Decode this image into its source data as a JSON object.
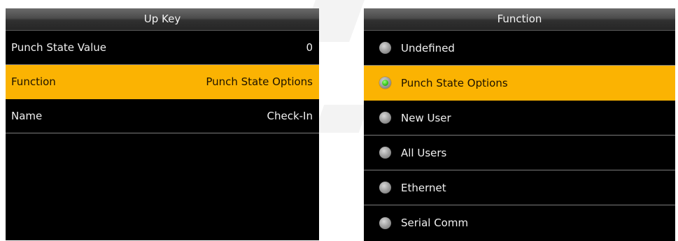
{
  "left_panel": {
    "title": "Up Key",
    "rows": [
      {
        "label": "Punch State Value",
        "value": "0"
      },
      {
        "label": "Function",
        "value": "Punch State Options"
      },
      {
        "label": "Name",
        "value": "Check-In"
      }
    ]
  },
  "right_panel": {
    "title": "Function",
    "options": [
      {
        "label": "Undefined"
      },
      {
        "label": "Punch State Options"
      },
      {
        "label": "New User"
      },
      {
        "label": "All Users"
      },
      {
        "label": "Ethernet"
      },
      {
        "label": "Serial Comm"
      }
    ]
  },
  "colors": {
    "selection": "#fbb302",
    "background": "#000000",
    "radio_active": "#34c219"
  },
  "icons": {
    "radio_off": "radio-unselected-icon",
    "radio_on": "radio-selected-icon"
  }
}
